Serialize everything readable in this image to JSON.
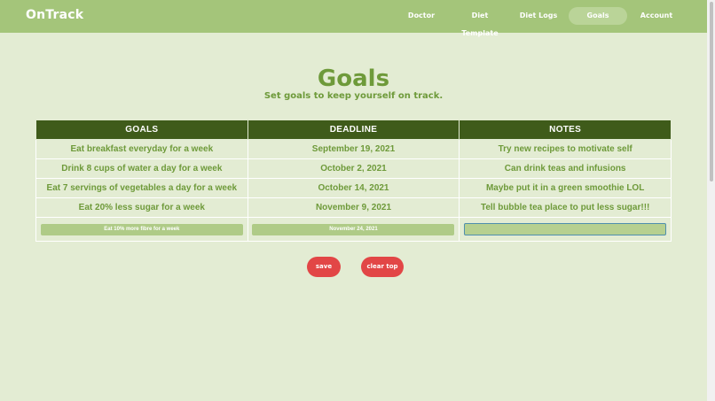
{
  "header": {
    "brand": "OnTrack",
    "nav": [
      {
        "label": "Doctor",
        "active": false
      },
      {
        "label": "Diet Template",
        "active": false
      },
      {
        "label": "Diet Logs",
        "active": false
      },
      {
        "label": "Goals",
        "active": true
      },
      {
        "label": "Account",
        "active": false
      }
    ]
  },
  "main": {
    "title": "Goals",
    "subtitle": "Set goals to keep yourself on track.",
    "table": {
      "headers": [
        "GOALS",
        "DEADLINE",
        "NOTES"
      ],
      "rows": [
        [
          "Eat breakfast everyday for a week",
          "September 19, 2021",
          "Try new recipes to motivate self"
        ],
        [
          "Drink 8 cups of water a day for a week",
          "October 2, 2021",
          "Can drink teas and infusions"
        ],
        [
          "Eat 7 servings of vegetables a day for a week",
          "October 14, 2021",
          "Maybe put it in a green smoothie LOL"
        ],
        [
          "Eat 20% less sugar for a week",
          "November 9, 2021",
          "Tell bubble tea place to put less sugar!!!"
        ]
      ],
      "new_row": {
        "goal_value": "Eat 10% more fibre for a week",
        "deadline_value": "November 24, 2021",
        "notes_value": ""
      }
    },
    "buttons": {
      "save": "save",
      "clear": "clear top"
    }
  },
  "colors": {
    "navbar": "#a4c57a",
    "background": "#e3ecd3",
    "table_header": "#3f5b1a",
    "accent_text": "#6e9a3a",
    "button": "#e24646"
  }
}
